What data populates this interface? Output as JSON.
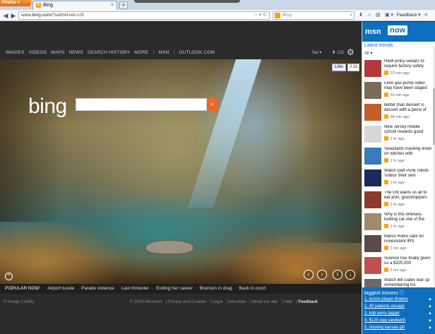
{
  "browser": {
    "menu_label": "Firefox",
    "tab_title": "Bing",
    "url_prefix": "www.",
    "url_domain": "bing.com",
    "url_path": "/?setmkt=en-US",
    "search_placeholder": "Bing",
    "feedback_label": "Feedback"
  },
  "bing": {
    "nav": [
      "IMAGES",
      "VIDEOS",
      "MAPS",
      "NEWS",
      "SEARCH HISTORY",
      "MORE",
      "MSN",
      "OUTLOOK.COM"
    ],
    "user_name": "Tad",
    "rewards_count": "132",
    "logo_text": "bing",
    "fb_like_label": "Like",
    "fb_like_count": "2.1k",
    "popular_label": "POPULAR NOW",
    "popular_items": [
      "Airport tussle",
      "Parade violence",
      "Last trimester",
      "Ending her career",
      "Branson in drag",
      "Back in court"
    ],
    "footer_credit": "© Image Credits",
    "footer_links": [
      "© 2013 Microsoft",
      "Privacy and Cookies",
      "Legal",
      "Advertise",
      "About our ads",
      "Help"
    ],
    "footer_feedback": "Feedback"
  },
  "msn": {
    "logo": "msn",
    "now": "now",
    "section_title": "Latest trends",
    "filter_label": "All",
    "trends": [
      {
        "title": "H&M pinky-swears to require factory safety",
        "time": "23 min ago",
        "thumb_color": "#b23a3a"
      },
      {
        "title": "Leno gas-pump video may have been staged",
        "time": "33 min ago",
        "thumb_color": "#7a6a5a"
      },
      {
        "title": "Better than dessert is dessert with a piece of",
        "time": "58 min ago",
        "thumb_color": "#c0602a"
      },
      {
        "title": "New Jersey middle school rewards good",
        "time": "1 hr ago",
        "thumb_color": "#d8d8d8"
      },
      {
        "title": "Swaziland cracking down on witches with",
        "time": "1 hr ago",
        "thumb_color": "#3a7ab8"
      },
      {
        "title": "Watch Daft Punk robots 'unbox' their own",
        "time": "1 hr ago",
        "thumb_color": "#1a2a5a"
      },
      {
        "title": "The UN wants us all to eat ants, grasshoppers",
        "time": "1 hr ago",
        "thumb_color": "#8a3a2a"
      },
      {
        "title": "Why is this ordinary-looking cat one of the",
        "time": "1 hr ago",
        "thumb_color": "#a08a6a"
      },
      {
        "title": "Marco Rubio calls for nonexistent IRS",
        "time": "2 hrs ago",
        "thumb_color": "#5a4a4a"
      },
      {
        "title": "Science has finally given us a $325,000",
        "time": "2 hrs ago",
        "thumb_color": "#c05050"
      },
      {
        "title": "Watch Bill Gates tear up remembering his",
        "time": "",
        "thumb_color": "#6a6a6a"
      }
    ],
    "movers_title": "biggest movers",
    "movers": [
      "1. tennis player drowns",
      "2. 40 patients escape",
      "3. kob perry jagger",
      "4. $120 egg sandwich",
      "5. missing kansas girl"
    ]
  },
  "colors": {
    "bing_orange": "#e8692c",
    "msn_blue": "#0e6fbf",
    "firefox_orange": "#f39a3b"
  }
}
